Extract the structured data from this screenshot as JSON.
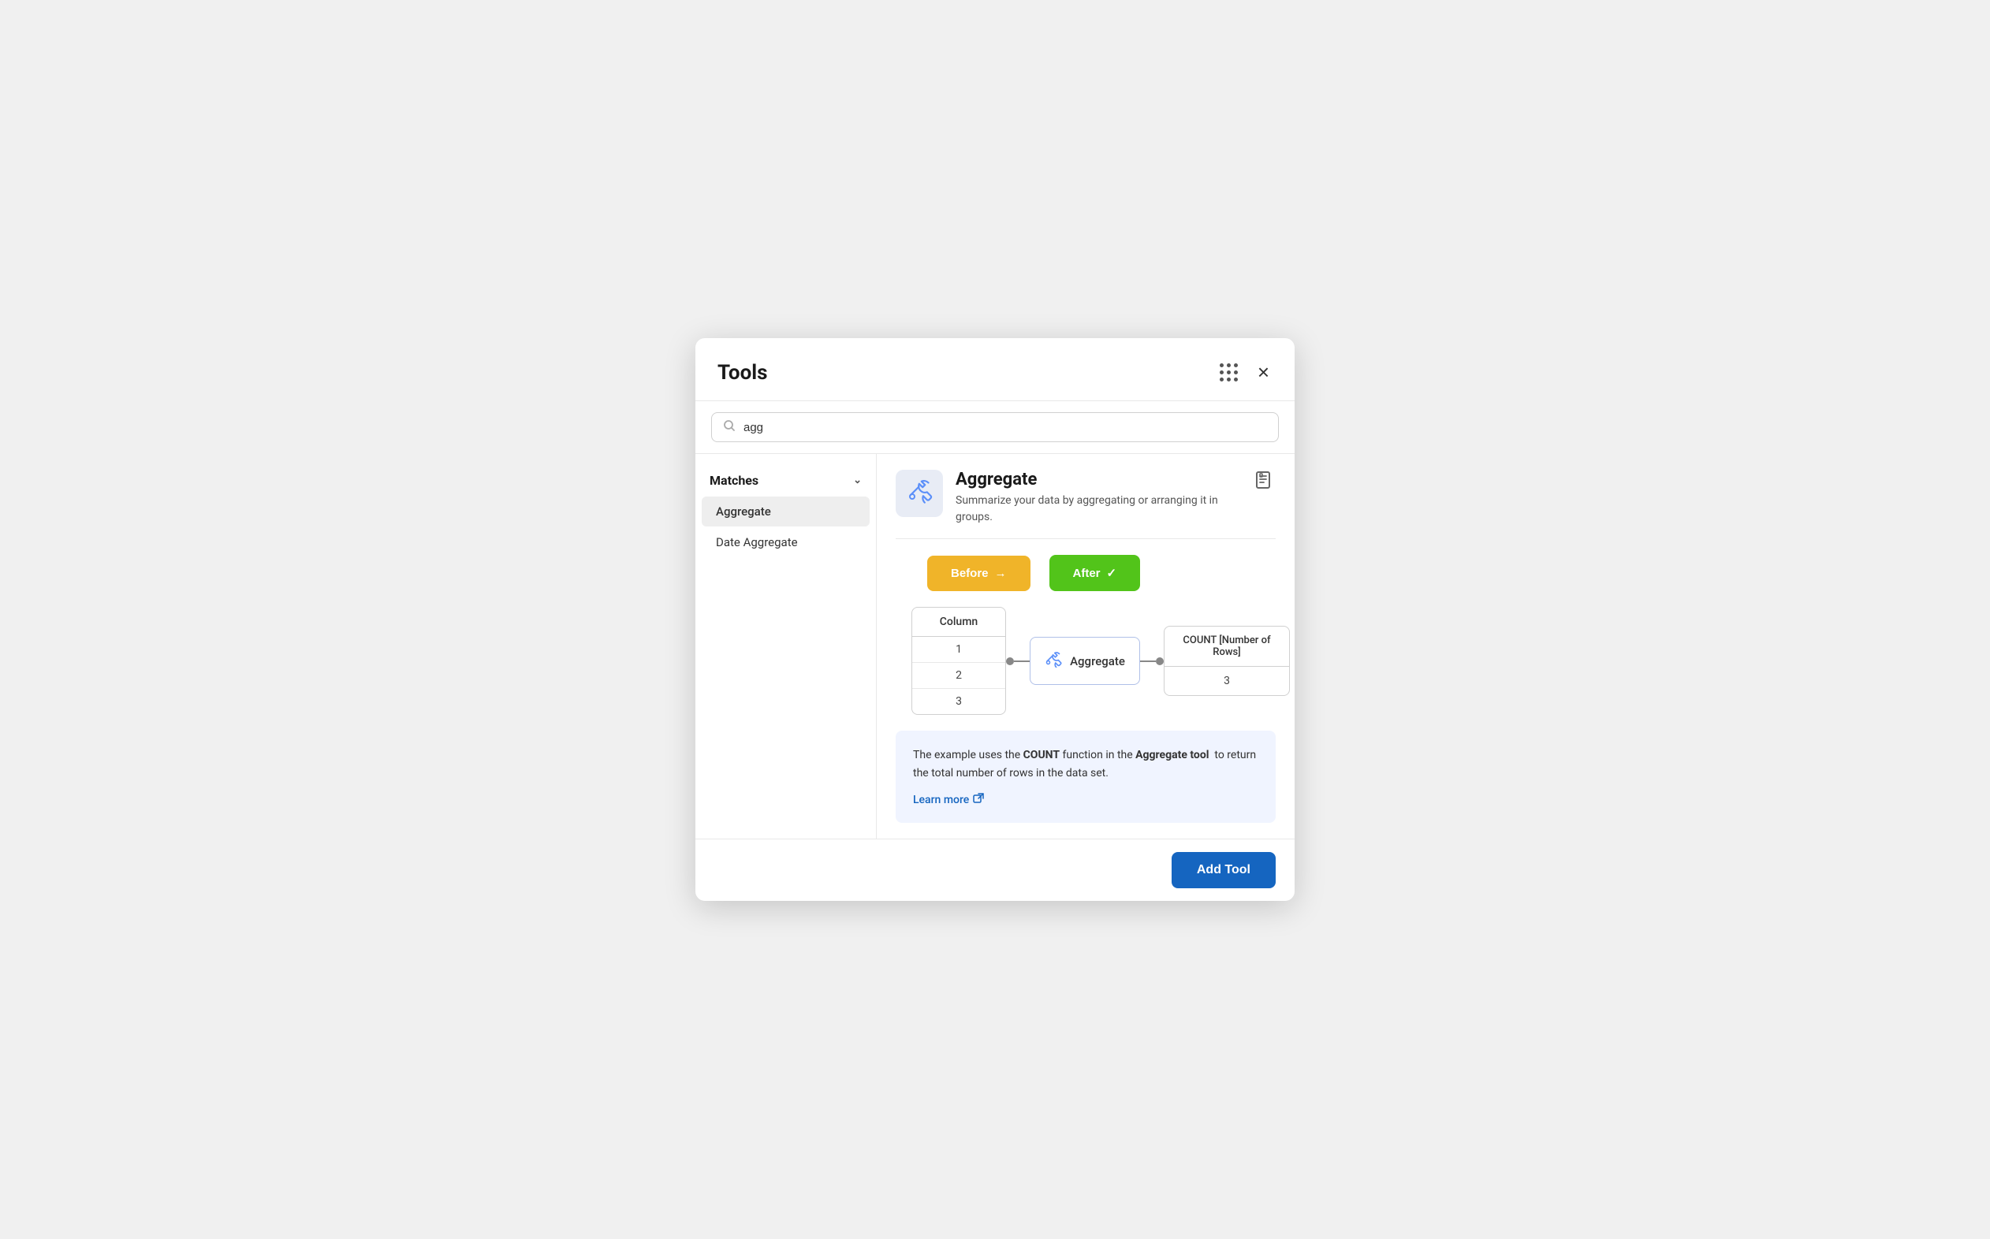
{
  "modal": {
    "title": "Tools",
    "close_label": "×"
  },
  "search": {
    "placeholder": "Search",
    "value": "agg"
  },
  "sidebar": {
    "matches_label": "Matches",
    "items": [
      {
        "label": "Aggregate",
        "active": true
      },
      {
        "label": "Date Aggregate",
        "active": false
      }
    ]
  },
  "tool": {
    "name": "Aggregate",
    "description": "Summarize your data by aggregating or arranging it in groups.",
    "before_label": "Before",
    "before_arrow": "→",
    "after_label": "After",
    "after_check": "✓",
    "diagram": {
      "input_column_header": "Column",
      "input_rows": [
        "1",
        "2",
        "3"
      ],
      "aggregate_label": "Aggregate",
      "output_header": "COUNT [Number of\nRows]",
      "output_value": "3"
    },
    "description_text_part1": "The example uses the ",
    "description_bold1": "COUNT",
    "description_text_part2": " function in the ",
    "description_bold2": "Aggregate tool",
    "description_text_part3": "  to return the total number of rows in the data set.",
    "learn_more_label": "Learn more",
    "add_tool_label": "Add Tool"
  }
}
